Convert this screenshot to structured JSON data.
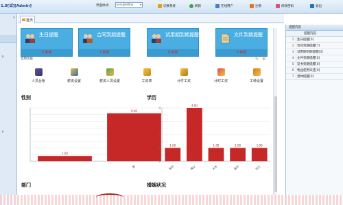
{
  "app": {
    "title": "1.0[试][Admin]"
  },
  "toolbar": {
    "skin_label": "界面样式:",
    "skin_value": "ui-cupertino",
    "buttons": [
      "切换系统",
      "刷新",
      "在线用户",
      "注销",
      "修改密码",
      "退出"
    ]
  },
  "tabs": [
    {
      "label": "首页"
    }
  ],
  "cards": [
    {
      "title": "生日提醒",
      "count": "0 条数",
      "icon": "users-icon"
    },
    {
      "title": "合同到期提醒",
      "count": "7 条数",
      "icon": "contract-users-icon"
    },
    {
      "title": "试用期到期提醒",
      "count": "0 条数",
      "icon": "users-icon"
    },
    {
      "title": "文件到期提醒",
      "count": "0 条数",
      "icon": "file-icon"
    }
  ],
  "common": {
    "label": "常用功能"
  },
  "functions": [
    {
      "label": "人员台帐",
      "icon": "staff-ledger-icon"
    },
    {
      "label": "薪资设置",
      "icon": "salary-settings-icon"
    },
    {
      "label": "薪资人员设置",
      "icon": "salary-staff-icon"
    },
    {
      "label": "工资表",
      "icon": "payroll-icon"
    },
    {
      "label": "计件工资",
      "icon": "piecework-icon"
    },
    {
      "label": "计时工资",
      "icon": "timewage-icon"
    },
    {
      "label": "工种设置",
      "icon": "jobtype-icon"
    }
  ],
  "sections": {
    "gender": "性别",
    "education": "学历",
    "department": "部门",
    "marriage": "婚姻状况"
  },
  "chart_data": [
    {
      "type": "bar",
      "title": "性别",
      "categories": [
        "",
        "男"
      ],
      "values": [
        1.0,
        9.0
      ],
      "value_labels": [
        "1.00",
        "9.00"
      ],
      "ylim": [
        0,
        10
      ],
      "grid": true
    },
    {
      "type": "bar",
      "title": "学历",
      "categories": [
        "本科",
        "博士",
        "大专",
        "高中",
        "初三"
      ],
      "values": [
        1.0,
        4.0,
        1.0,
        1.0,
        1.0
      ],
      "value_labels": [
        "1.00",
        "4.00",
        "1.00",
        "1.00",
        "1.00"
      ],
      "ylim": [
        0,
        4
      ],
      "yticks": [
        "0",
        "1",
        "2",
        "3",
        "4"
      ],
      "grid": true
    }
  ],
  "reminders": {
    "header": "提醒内容",
    "column": "提醒内容",
    "rows": [
      {
        "n": "1",
        "text": "生日提醒[0]"
      },
      {
        "n": "2",
        "text": "合同到期提醒[7]"
      },
      {
        "n": "3",
        "text": "试用期到期提醒[0]"
      },
      {
        "n": "4",
        "text": "文件到期提醒[0]"
      },
      {
        "n": "5",
        "text": "证书到期提醒[0]"
      },
      {
        "n": "6",
        "text": "物品使用归还[0]"
      },
      {
        "n": "7",
        "text": "退休提醒[0]"
      }
    ]
  },
  "colors": {
    "card": "#4aaee3",
    "bar": "#c62828",
    "accent": "#1a3f8a"
  }
}
